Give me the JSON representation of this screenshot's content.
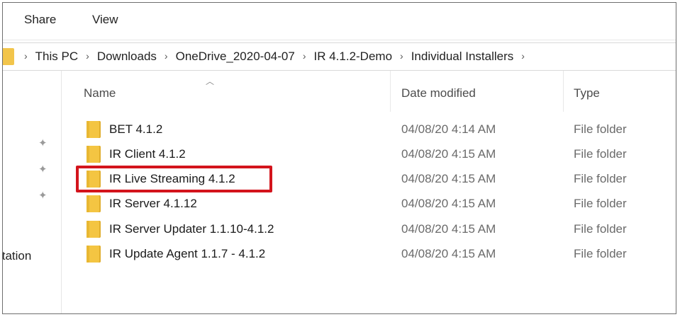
{
  "ribbon": {
    "tabs": [
      "Share",
      "View"
    ]
  },
  "address": {
    "crumbs": [
      "This PC",
      "Downloads",
      "OneDrive_2020-04-07",
      "IR 4.1.2-Demo",
      "Individual Installers"
    ],
    "separator": "›"
  },
  "navpane": {
    "partial_label": "ıtation"
  },
  "columns": {
    "name": "Name",
    "date": "Date modified",
    "type": "Type"
  },
  "files": [
    {
      "name": "BET 4.1.2",
      "date": "04/08/20 4:14 AM",
      "type": "File folder"
    },
    {
      "name": "IR Client 4.1.2",
      "date": "04/08/20 4:15 AM",
      "type": "File folder"
    },
    {
      "name": "IR Live Streaming 4.1.2",
      "date": "04/08/20 4:15 AM",
      "type": "File folder"
    },
    {
      "name": "IR Server 4.1.12",
      "date": "04/08/20 4:15 AM",
      "type": "File folder"
    },
    {
      "name": "IR Server Updater 1.1.10-4.1.2",
      "date": "04/08/20 4:15 AM",
      "type": "File folder"
    },
    {
      "name": "IR Update Agent 1.1.7 - 4.1.2",
      "date": "04/08/20 4:15 AM",
      "type": "File folder"
    }
  ],
  "colors": {
    "highlight": "#d3141c",
    "folder": "#f4c542"
  }
}
